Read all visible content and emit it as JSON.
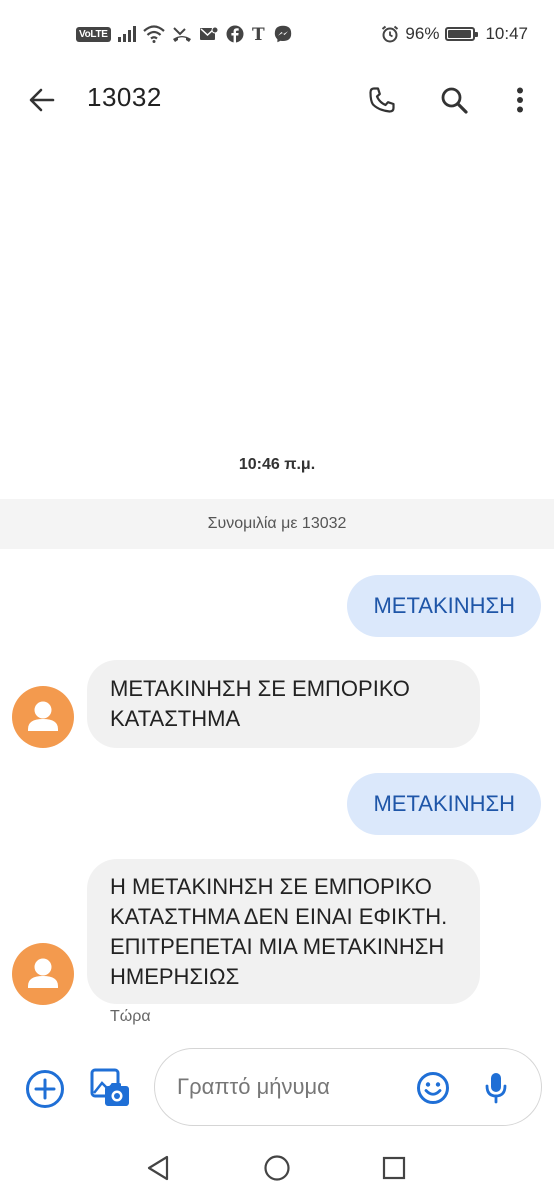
{
  "status_bar": {
    "volte_label": "VoLTE",
    "battery_text": "96%",
    "battery_level": 0.96,
    "time": "10:47",
    "icons": [
      "signal-icon",
      "wifi-icon",
      "missed-call-icon",
      "notification-icon",
      "facebook-icon",
      "nytimes-icon",
      "messenger-icon",
      "alarm-icon",
      "battery-icon"
    ]
  },
  "header": {
    "title": "13032",
    "icons": [
      "back-arrow-icon",
      "phone-icon",
      "search-icon",
      "more-vert-icon"
    ]
  },
  "conversation": {
    "timestamp": "10:46 π.μ.",
    "banner": "Συνομιλία με 13032",
    "messages": [
      {
        "direction": "outgoing",
        "text": "ΜΕΤΑΚΙΝΗΣΗ"
      },
      {
        "direction": "incoming",
        "text": "ΜΕΤΑΚΙΝΗΣΗ ΣΕ ΕΜΠΟΡΙΚΟ ΚΑΤΑΣΤΗΜΑ"
      },
      {
        "direction": "outgoing",
        "text": "ΜΕΤΑΚΙΝΗΣΗ"
      },
      {
        "direction": "incoming",
        "text": "Η ΜΕΤΑΚΙΝΗΣΗ ΣΕ ΕΜΠΟΡΙΚΟ ΚΑΤΑΣΤΗΜΑ ΔΕΝ ΕΙΝΑΙ ΕΦΙΚΤΗ. ΕΠΙΤΡΕΠΕΤΑΙ ΜΙΑ ΜΕΤΑΚΙΝΗΣΗ ΗΜΕΡΗΣΙΩΣ"
      }
    ],
    "last_message_time": "Τώρα"
  },
  "composer": {
    "placeholder": "Γραπτό μήνυμα",
    "value": "",
    "icons": [
      "add-circle-icon",
      "gallery-camera-icon",
      "emoji-icon",
      "microphone-icon"
    ]
  },
  "navigation_bar": {
    "icons": [
      "nav-back-icon",
      "nav-home-icon",
      "nav-recents-icon"
    ]
  },
  "colors": {
    "accent": "#1f6fd6",
    "outgoing_bubble": "#dbe8fb",
    "outgoing_text": "#1f56a8",
    "incoming_bubble": "#f1f1f1",
    "avatar": "#f39a4e",
    "banner_bg": "#f4f4f4"
  }
}
